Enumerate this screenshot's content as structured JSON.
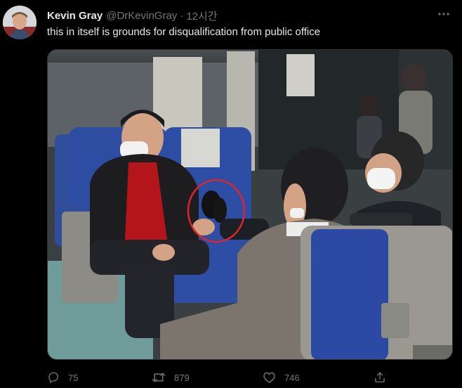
{
  "author": {
    "display_name": "Kevin Gray",
    "handle": "@DrKevinGray",
    "separator": "·",
    "timestamp": "12시간"
  },
  "tweet": {
    "text": "this in itself is grounds for disqualification from public office"
  },
  "media": {
    "kind": "photo",
    "highlight_color": "#d9262c"
  },
  "actions": {
    "reply_count": "75",
    "retweet_count": "879",
    "like_count": "746"
  },
  "icons": {
    "more": "more-horizontal-icon",
    "reply": "reply-icon",
    "retweet": "retweet-icon",
    "like": "heart-icon",
    "share": "share-icon"
  },
  "colors": {
    "background": "#000000",
    "text_primary": "#e7e9ea",
    "text_secondary": "#71767b"
  }
}
